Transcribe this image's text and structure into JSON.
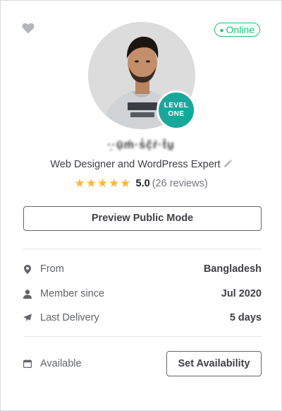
{
  "status": {
    "online_label": "Online"
  },
  "profile": {
    "username": "·̣·ụ̄ḿ·ṡ̇ĉ̣ṙ·ṫ̄ṵ",
    "level_line1": "LEVEL",
    "level_line2": "ONE",
    "tagline": "Web Designer and WordPress Expert",
    "rating_stars": 5,
    "rating_score": "5.0",
    "rating_reviews": "(26 reviews)"
  },
  "actions": {
    "preview_label": "Preview Public Mode",
    "set_availability_label": "Set Availability"
  },
  "stats": [
    {
      "icon": "location-pin-icon",
      "label": "From",
      "value": "Bangladesh"
    },
    {
      "icon": "user-icon",
      "label": "Member since",
      "value": "Jul 2020"
    },
    {
      "icon": "paper-plane-icon",
      "label": "Last Delivery",
      "value": "5 days"
    }
  ],
  "availability": {
    "icon": "calendar-icon",
    "label": "Available"
  },
  "colors": {
    "online_green": "#1dbf73",
    "level_badge_teal": "#1ba69c",
    "star_gold": "#ffb33e",
    "text_dark": "#404145",
    "text_muted": "#62646a"
  }
}
